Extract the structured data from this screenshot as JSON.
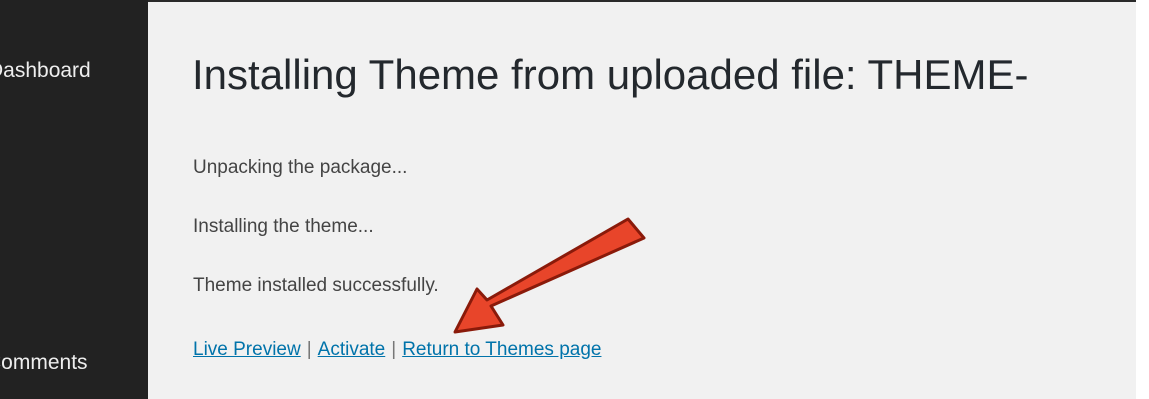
{
  "sidebar": {
    "items": [
      {
        "label": "Dashboard"
      },
      {
        "label": "Comments"
      }
    ]
  },
  "main": {
    "title": "Installing Theme from uploaded file: THEME-",
    "messages": [
      "Unpacking the package...",
      "Installing the theme...",
      "Theme installed successfully."
    ],
    "actions": {
      "live_preview": "Live Preview",
      "separator": "|",
      "activate": "Activate",
      "return": "Return to Themes page"
    }
  },
  "annotation": {
    "type": "arrow",
    "target": "activate-link",
    "color": "#e8452a",
    "outline": "#8a1a0a"
  },
  "colors": {
    "sidebar_bg": "#222222",
    "content_bg": "#f1f1f1",
    "link": "#0073aa"
  }
}
